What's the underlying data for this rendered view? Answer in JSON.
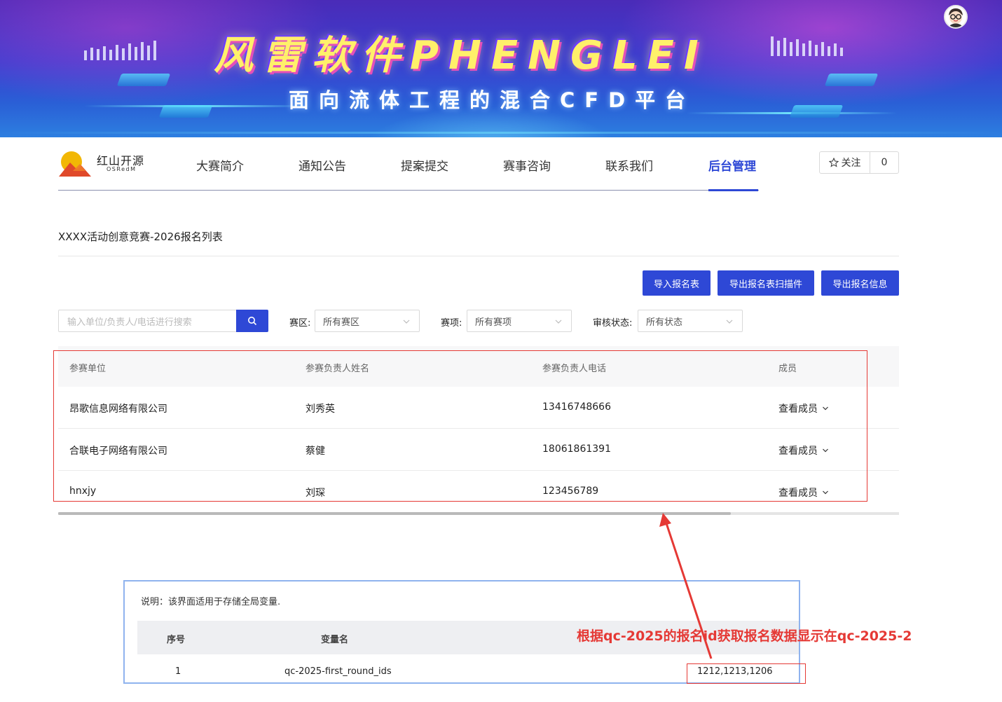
{
  "banner": {
    "title": "风雷软件PHENGLEI",
    "subtitle": "面向流体工程的混合CFD平台"
  },
  "logo": {
    "name": "红山开源",
    "sub": "OSRedM"
  },
  "nav": {
    "items": [
      "大赛简介",
      "通知公告",
      "提案提交",
      "赛事咨询",
      "联系我们",
      "后台管理"
    ],
    "active": "后台管理"
  },
  "follow": {
    "label": "关注",
    "count": "0"
  },
  "page": {
    "title": "XXXX活动创意竞赛-2026报名列表"
  },
  "actions": {
    "import": "导入报名表",
    "export_scan": "导出报名表扫描件",
    "export_info": "导出报名信息"
  },
  "filters": {
    "search_placeholder": "输入单位/负责人/电话进行搜索",
    "zone_label": "赛区:",
    "zone_value": "所有赛区",
    "event_label": "赛项:",
    "event_value": "所有赛项",
    "status_label": "审核状态:",
    "status_value": "所有状态"
  },
  "table": {
    "columns": [
      "参赛单位",
      "参赛负责人姓名",
      "参赛负责人电话",
      "成员"
    ],
    "rows": [
      {
        "org": "昂歌信息网络有限公司",
        "name": "刘秀英",
        "phone": "13416748666",
        "members": "查看成员"
      },
      {
        "org": "合联电子网络有限公司",
        "name": "蔡健",
        "phone": "18061861391",
        "members": "查看成员"
      },
      {
        "org": "hnxjy",
        "name": "刘琛",
        "phone": "123456789",
        "members": "查看成员"
      }
    ]
  },
  "variables_panel": {
    "note": "说明：该界面适用于存储全局变量.",
    "columns": [
      "序号",
      "变量名"
    ],
    "row": {
      "index": "1",
      "name": "qc-2025-first_round_ids",
      "value": "1212,1213,1206"
    }
  },
  "annotation": {
    "text": "根据qc-2025的报名id获取报名数据显示在qc-2025-2",
    "color": "#e53935"
  },
  "colors": {
    "primary": "#2e48d6",
    "annotation": "#e53935"
  }
}
